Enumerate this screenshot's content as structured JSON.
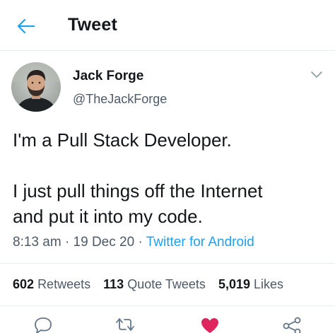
{
  "header": {
    "title": "Tweet",
    "back_icon": "arrow-left-icon",
    "accent_color": "#1da1f2"
  },
  "author": {
    "display_name": "Jack Forge",
    "handle": "@TheJackForge",
    "avatar_icon": "profile-photo"
  },
  "tweet": {
    "lines_paragraph_1": [
      "I'm a Pull Stack Developer."
    ],
    "lines_paragraph_2": [
      "I just pull things off the Internet",
      "and put it into my code."
    ]
  },
  "meta": {
    "time": "8:13 am",
    "separator": "·",
    "date": "19 Dec 20",
    "source": "Twitter for Android"
  },
  "stats": {
    "retweets_count": "602",
    "retweets_label": "Retweets",
    "quotes_count": "113",
    "quotes_label": "Quote Tweets",
    "likes_count": "5,019",
    "likes_label": "Likes"
  },
  "actions": {
    "icons": [
      "reply-icon",
      "retweet-icon",
      "like-heart-icon",
      "share-icon"
    ],
    "like_color": "#e0245e",
    "icon_color": "#657786"
  }
}
